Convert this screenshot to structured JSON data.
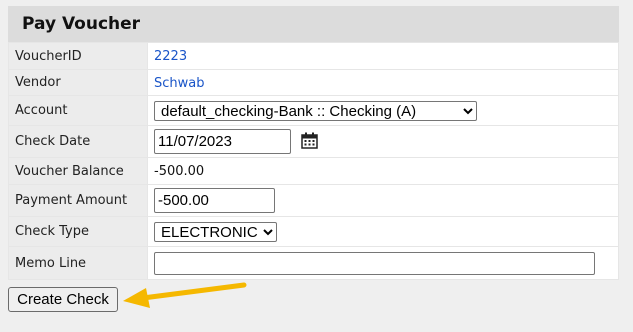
{
  "panel": {
    "title": "Pay Voucher"
  },
  "form": {
    "voucher_id": {
      "label": "VoucherID",
      "value": "2223"
    },
    "vendor": {
      "label": "Vendor",
      "value": "Schwab"
    },
    "account": {
      "label": "Account",
      "selected": "default_checking-Bank :: Checking (A)"
    },
    "check_date": {
      "label": "Check Date",
      "value": "11/07/2023"
    },
    "voucher_balance": {
      "label": "Voucher Balance",
      "value": "-500.00"
    },
    "payment_amount": {
      "label": "Payment Amount",
      "value": "-500.00"
    },
    "check_type": {
      "label": "Check Type",
      "selected": "ELECTRONIC"
    },
    "memo_line": {
      "label": "Memo Line",
      "value": ""
    }
  },
  "actions": {
    "create_check_label": "Create Check"
  },
  "icons": {
    "calendar": "calendar-icon",
    "annotation_arrow": "arrow-icon"
  },
  "colors": {
    "link": "#1a55c8",
    "arrow": "#f5b800",
    "header_bg": "#dcdcdc"
  }
}
